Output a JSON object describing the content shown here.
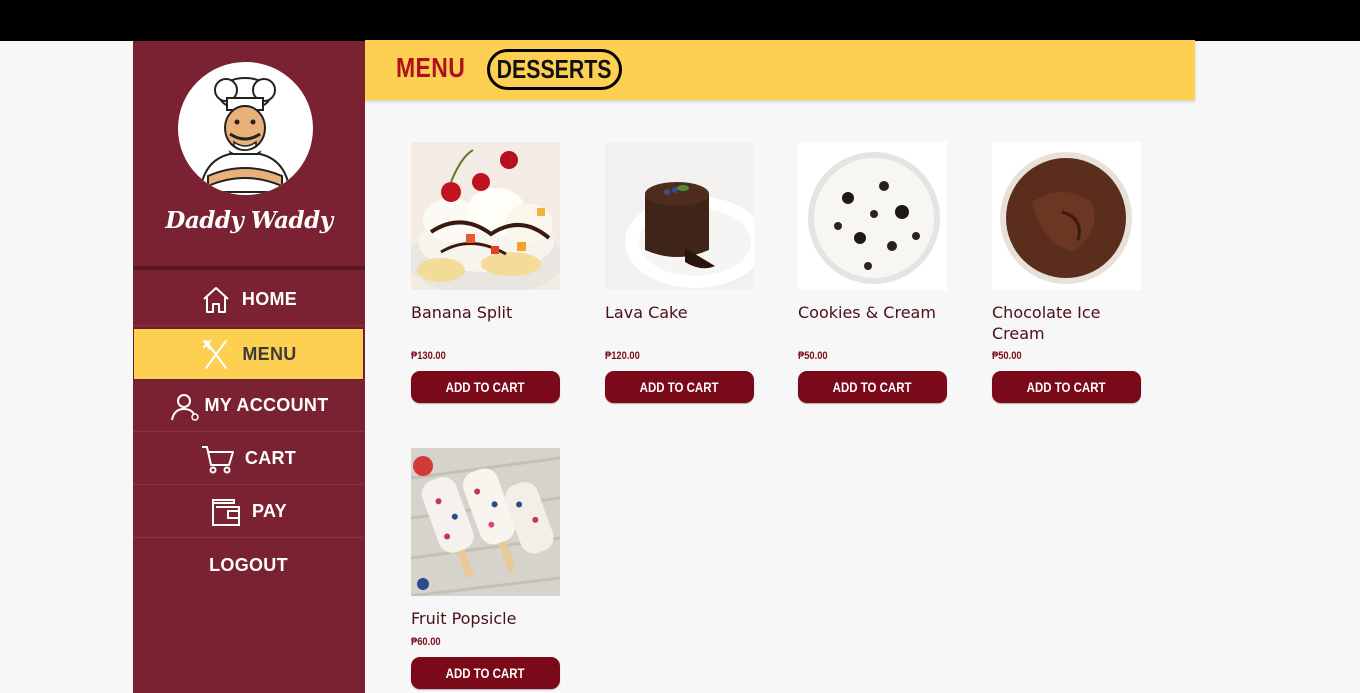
{
  "brand": {
    "name": "Daddy Waddy"
  },
  "sidebar": {
    "items": [
      {
        "label": "HOME",
        "icon": "home-icon"
      },
      {
        "label": "MENU",
        "icon": "utensils-icon",
        "active": true
      },
      {
        "label": "MY ACCOUNT",
        "icon": "user-icon"
      },
      {
        "label": "CART",
        "icon": "cart-icon"
      },
      {
        "label": "PAY",
        "icon": "wallet-icon"
      },
      {
        "label": "LOGOUT"
      }
    ]
  },
  "header": {
    "title": "MENU",
    "category": "DESSERTS"
  },
  "products": [
    {
      "name": "Banana Split",
      "price": "₱130.00",
      "button": "ADD TO CART"
    },
    {
      "name": "Lava Cake",
      "price": "₱120.00",
      "button": "ADD TO CART"
    },
    {
      "name": "Cookies & Cream",
      "price": "₱50.00",
      "button": "ADD TO CART"
    },
    {
      "name": "Chocolate Ice Cream",
      "price": "₱50.00",
      "button": "ADD TO CART"
    },
    {
      "name": "Fruit Popsicle",
      "price": "₱60.00",
      "button": "ADD TO CART"
    }
  ],
  "colors": {
    "sidebar": "#7a2231",
    "accent": "#fdd052",
    "button": "#7a0a1a",
    "title": "#b00f1f"
  }
}
